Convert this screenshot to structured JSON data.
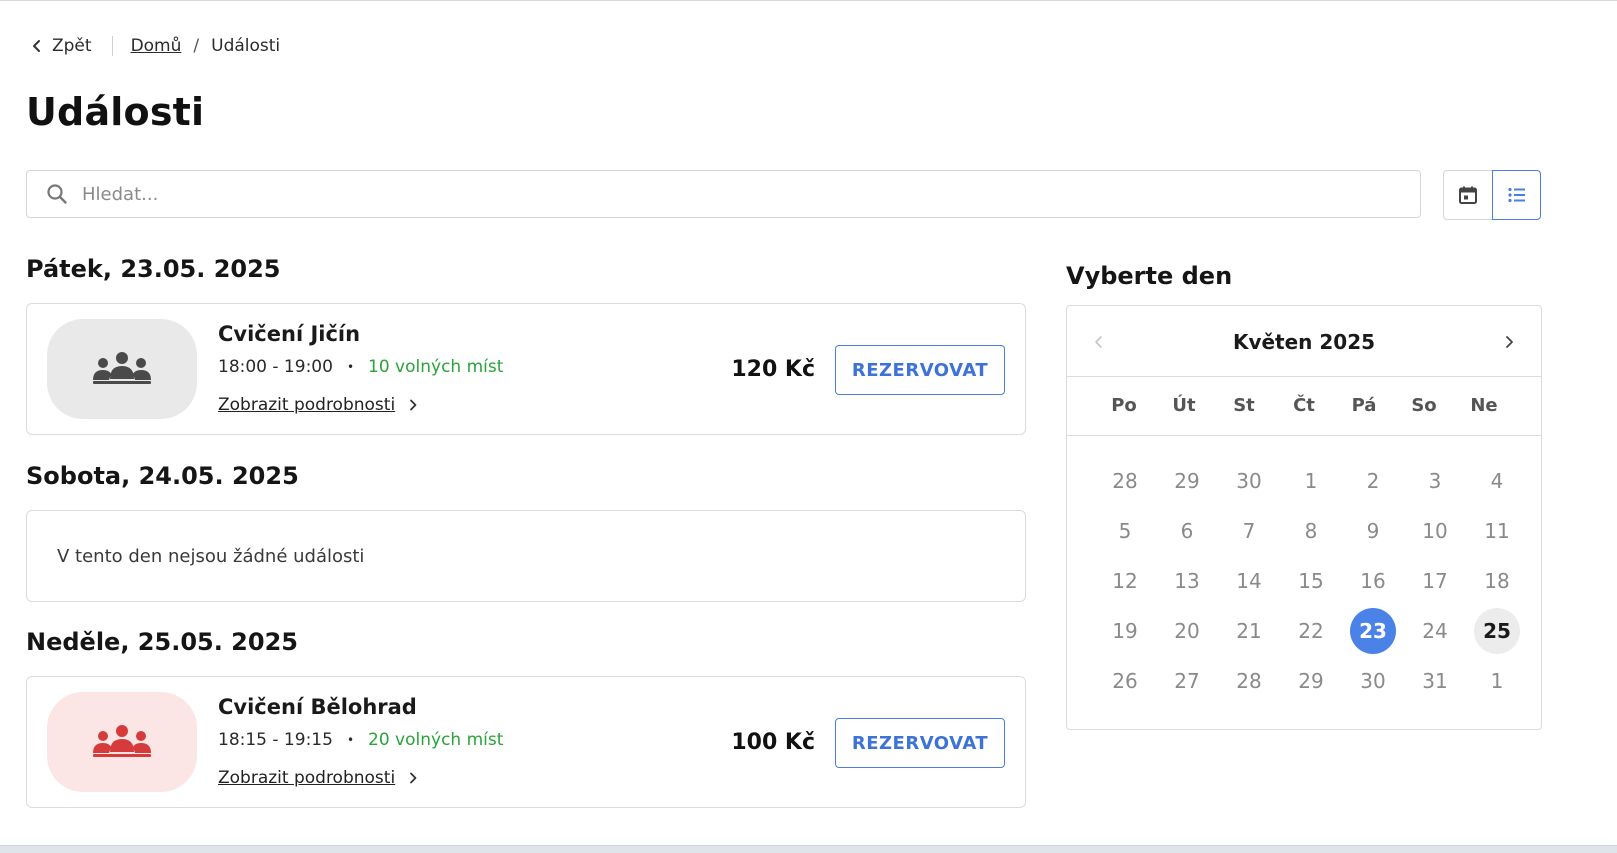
{
  "breadcrumb": {
    "back_label": "Zpět",
    "home_label": "Domů",
    "separator": "/",
    "current_label": "Události"
  },
  "page": {
    "title": "Události"
  },
  "search": {
    "placeholder": "Hledat...",
    "value": ""
  },
  "view_toggle": {
    "options": [
      {
        "icon": "calendar-icon",
        "active": false
      },
      {
        "icon": "list-icon",
        "active": true
      }
    ],
    "accent_color": "#4a7fe0"
  },
  "days": [
    {
      "heading": "Pátek, 23.05. 2025",
      "event": {
        "name": "Cvičení Jičín",
        "time": "18:00 - 19:00",
        "bullet": "•",
        "spots": "10 volných míst",
        "details_label": "Zobrazit podrobnosti",
        "price": "120 Kč",
        "book_label": "REZERVOVAT",
        "icon": "group-icon",
        "thumb_color": "#e9e9e9",
        "icon_color": "#4a4a4a"
      }
    },
    {
      "heading": "Sobota, 24.05. 2025",
      "empty_text": "V tento den nejsou žádné události"
    },
    {
      "heading": "Neděle, 25.05. 2025",
      "event": {
        "name": "Cvičení Bělohrad",
        "time": "18:15 - 19:15",
        "bullet": "•",
        "spots": "20 volných míst",
        "details_label": "Zobrazit podrobnosti",
        "price": "100 Kč",
        "book_label": "REZERVOVAT",
        "icon": "group-icon",
        "thumb_color": "#fbe5e5",
        "icon_color": "#d63b3b"
      }
    }
  ],
  "calendar": {
    "heading": "Vyberte den",
    "month_label": "Květen 2025",
    "weekdays": [
      "Po",
      "Út",
      "St",
      "Čt",
      "Pá",
      "So",
      "Ne"
    ],
    "days": [
      "28",
      "29",
      "30",
      "1",
      "2",
      "3",
      "4",
      "5",
      "6",
      "7",
      "8",
      "9",
      "10",
      "11",
      "12",
      "13",
      "14",
      "15",
      "16",
      "17",
      "18",
      "19",
      "20",
      "21",
      "22",
      "23",
      "24",
      "25",
      "26",
      "27",
      "28",
      "29",
      "30",
      "31",
      "1"
    ],
    "selected_day": "23",
    "today_day": "25",
    "selected_color": "#4a82e8"
  },
  "colors": {
    "available_green": "#2aa33a",
    "accent_blue": "#4a7fe0"
  }
}
